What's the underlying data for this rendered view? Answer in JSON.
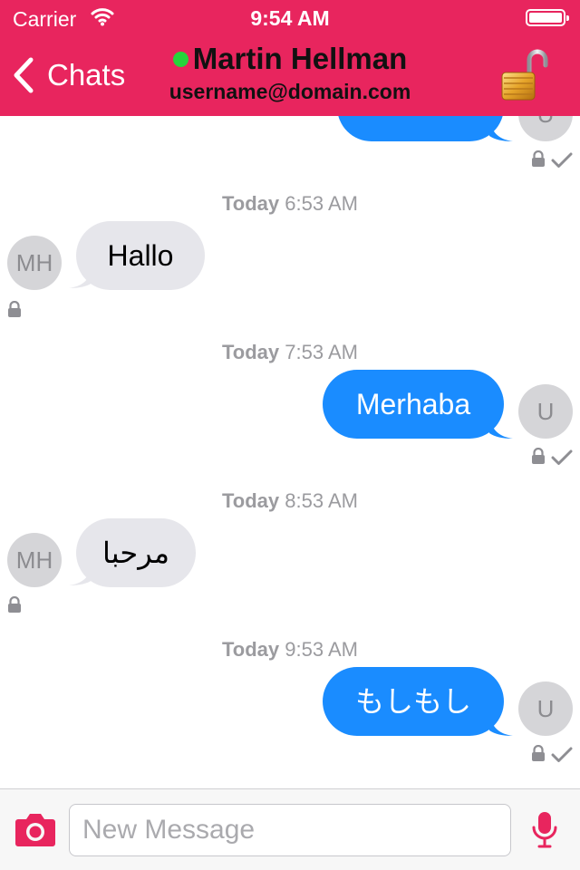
{
  "status_bar": {
    "carrier": "Carrier",
    "time": "9:54 AM"
  },
  "nav": {
    "back_label": "Chats",
    "contact_name": "Martin Hellman",
    "contact_subtitle": "username@domain.com",
    "online_color": "#27d43b",
    "accent_color": "#e8255e"
  },
  "messages": [
    {
      "timestamp_day": "Today",
      "timestamp_time": "6:53 AM",
      "direction": "incoming",
      "avatar": "MH",
      "text": "Hallo"
    },
    {
      "timestamp_day": "Today",
      "timestamp_time": "7:53 AM",
      "direction": "outgoing",
      "avatar": "U",
      "text": "Merhaba"
    },
    {
      "timestamp_day": "Today",
      "timestamp_time": "8:53 AM",
      "direction": "incoming",
      "avatar": "MH",
      "text": "مرحبا"
    },
    {
      "timestamp_day": "Today",
      "timestamp_time": "9:53 AM",
      "direction": "outgoing",
      "avatar": "U",
      "text": "もしもし"
    }
  ],
  "partial_top": {
    "avatar": "U"
  },
  "composer": {
    "placeholder": "New Message"
  },
  "colors": {
    "outgoing_bubble": "#1a8cff",
    "incoming_bubble": "#e6e6eb"
  }
}
